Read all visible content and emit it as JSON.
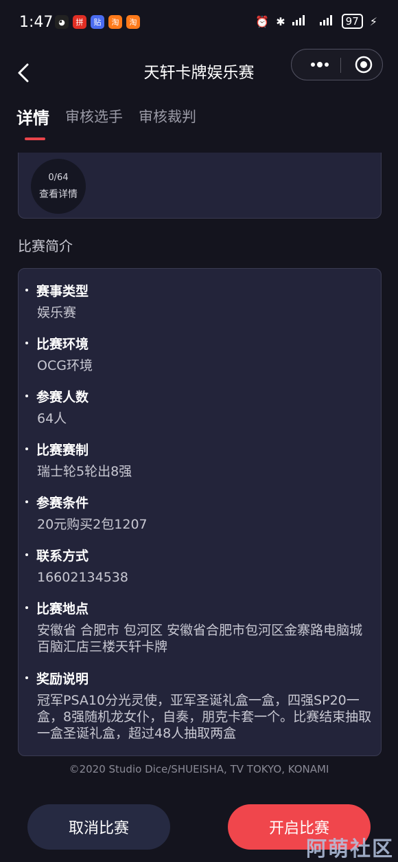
{
  "status_bar": {
    "time": "1:47",
    "battery": "97",
    "app_icons": [
      {
        "name": "qq-icon",
        "color": "#222222",
        "glyph": "◕"
      },
      {
        "name": "pdd-icon",
        "color": "#e02e24",
        "glyph": "拼"
      },
      {
        "name": "tieba-icon",
        "color": "#4a6cf0",
        "glyph": "贴"
      },
      {
        "name": "taobao-icon",
        "color": "#ff7a1a",
        "glyph": "淘"
      },
      {
        "name": "taobao-icon-2",
        "color": "#ff7a1a",
        "glyph": "淘"
      }
    ]
  },
  "header": {
    "title": "天轩卡牌娱乐赛"
  },
  "tabs": [
    {
      "label": "详情",
      "active": true
    },
    {
      "label": "审核选手",
      "active": false
    },
    {
      "label": "审核裁判",
      "active": false
    }
  ],
  "registration": {
    "count": "0/64",
    "link": "查看详情"
  },
  "intro_title": "比赛简介",
  "info_items": [
    {
      "label": "赛事类型",
      "value": "娱乐赛"
    },
    {
      "label": "比赛环境",
      "value": "OCG环境"
    },
    {
      "label": "参赛人数",
      "value": "64人"
    },
    {
      "label": "比赛赛制",
      "value": "瑞士轮5轮出8强"
    },
    {
      "label": "参赛条件",
      "value": "20元购买2包1207"
    },
    {
      "label": "联系方式",
      "value": "16602134538"
    },
    {
      "label": "比赛地点",
      "value": "安徽省 合肥市 包河区 安徽省合肥市包河区金寨路电脑城百脑汇店三楼天轩卡牌"
    },
    {
      "label": "奖励说明",
      "value": "冠军PSA10分光灵使，亚军圣诞礼盒一盒，四强SP20一盒，8强随机龙女仆，自奏，朋克卡套一个。比赛结束抽取一盒圣诞礼盒，超过48人抽取两盒"
    }
  ],
  "copyright": "©2020 Studio Dice/SHUEISHA, TV TOKYO, KONAMI",
  "actions": {
    "cancel_label": "取消比赛",
    "start_label": "开启比赛"
  },
  "watermark": "阿萌社区",
  "colors": {
    "accent": "#f0464c",
    "background": "#14141e",
    "card": "#23243a",
    "cancel_button": "#262a42"
  }
}
